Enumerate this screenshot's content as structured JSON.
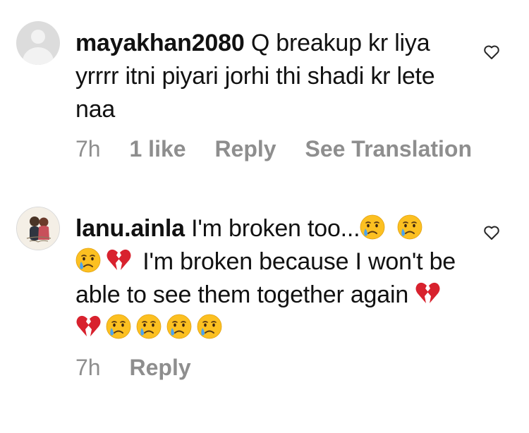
{
  "comments": [
    {
      "username": "mayakhan2080",
      "text": "Q breakup kr liya yrrrr itni piyari jorhi thi shadi kr lete naa",
      "time": "7h",
      "likes": "1 like",
      "reply_label": "Reply",
      "translate_label": "See Translation",
      "avatar": "default-avatar",
      "like_icon": "heart-outline-icon"
    },
    {
      "username": "lanu.ainla",
      "text_part1": "I'm broken too...",
      "text_part2": "I'm broken because I won't be able to see them together again",
      "emojis": [
        "crying-face",
        "crying-face",
        "crying-face",
        "broken-heart",
        "broken-heart",
        "broken-heart",
        "crying-face",
        "crying-face",
        "crying-face",
        "crying-face"
      ],
      "time": "7h",
      "reply_label": "Reply",
      "avatar": "profile-photo",
      "like_icon": "heart-outline-icon"
    }
  ],
  "colors": {
    "text": "#111111",
    "meta": "#8e8e8e",
    "emoji_face": "#fcc021",
    "tear": "#4aa3f0",
    "broken_heart": "#d8222e"
  }
}
